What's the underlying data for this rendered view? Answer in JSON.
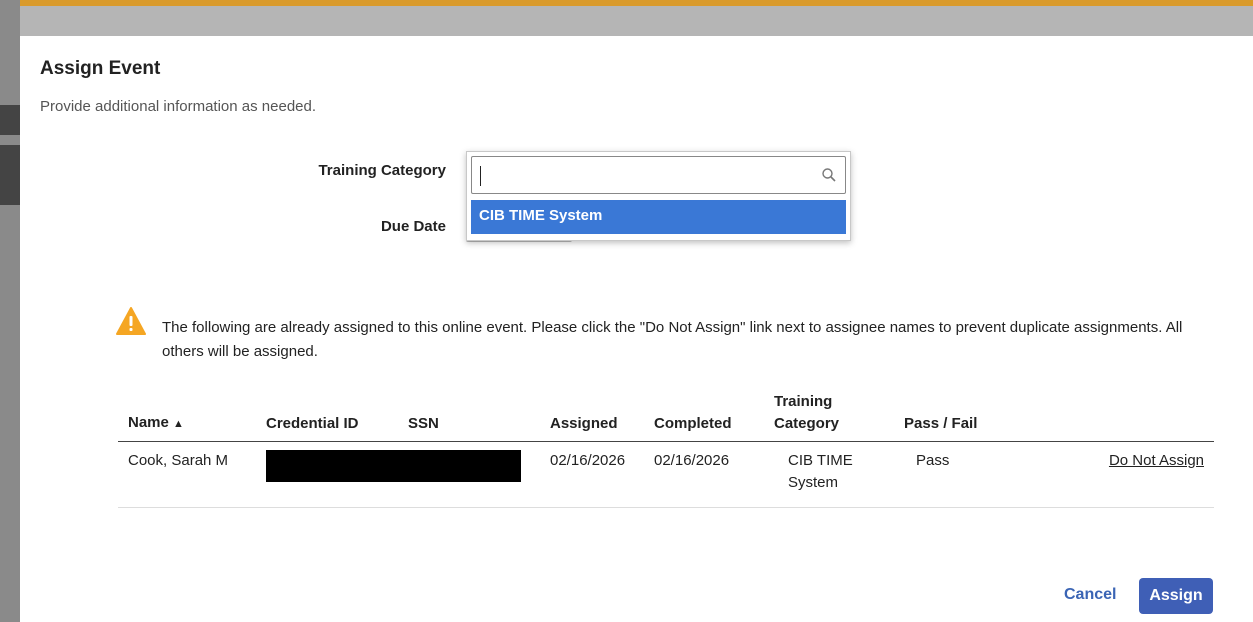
{
  "modal": {
    "title": "Assign Event",
    "subtitle": "Provide additional information as needed."
  },
  "form": {
    "training_category_label": "Training Category",
    "due_date_label": "Due Date",
    "training_category_value": "",
    "dropdown_options": [
      "CIB TIME System"
    ]
  },
  "warning": {
    "text": "The following are already assigned to this online event. Please click the \"Do Not Assign\" link next to assignee names to prevent duplicate assignments. All others will be assigned."
  },
  "table": {
    "headers": {
      "name": "Name",
      "sort_indicator": "▲",
      "credential_id": "Credential ID",
      "ssn": "SSN",
      "assigned": "Assigned",
      "completed": "Completed",
      "training_category": "Training Category",
      "pass_fail": "Pass / Fail"
    },
    "rows": [
      {
        "name": "Cook, Sarah M",
        "credential_id": "",
        "ssn": "",
        "assigned": "02/16/2026",
        "completed": "02/16/2026",
        "training_category": "CIB TIME System",
        "pass_fail": "Pass",
        "action": "Do Not Assign"
      }
    ]
  },
  "footer": {
    "cancel_label": "Cancel",
    "assign_label": "Assign"
  },
  "colors": {
    "accent": "#3a78d6",
    "primary_button": "#3f5fb6",
    "warning": "#f5a623"
  }
}
